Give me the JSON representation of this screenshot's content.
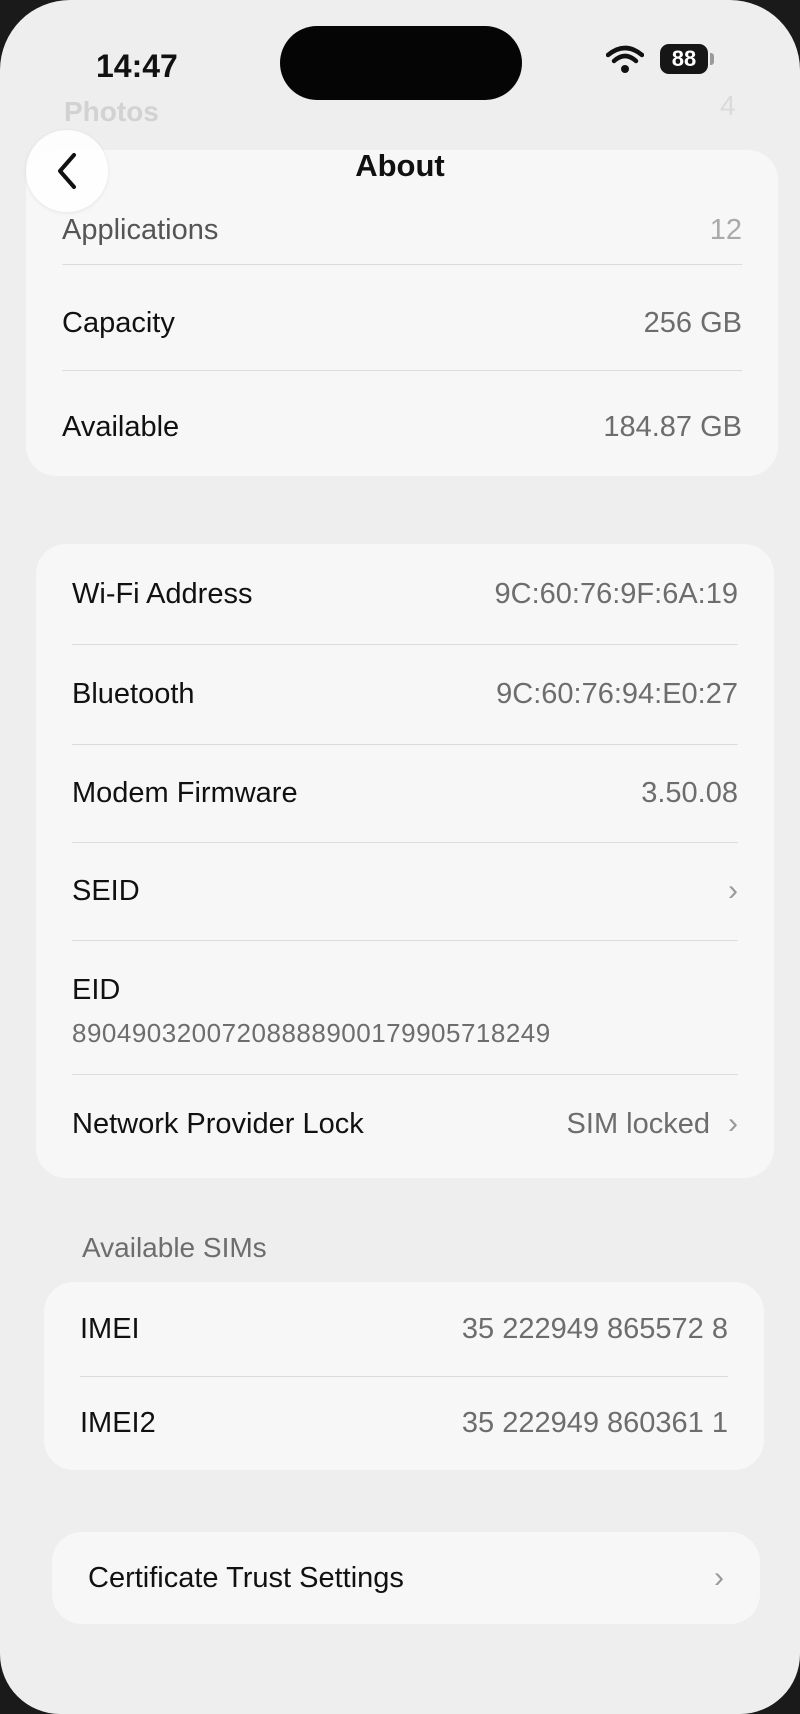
{
  "status_bar": {
    "time": "14:47",
    "battery": "88"
  },
  "ghost_header": {
    "title": "Photos",
    "value": "4"
  },
  "nav": {
    "title": "About"
  },
  "storage_group": [
    {
      "label": "Applications",
      "value": "12"
    },
    {
      "label": "Capacity",
      "value": "256 GB"
    },
    {
      "label": "Available",
      "value": "184.87 GB"
    }
  ],
  "hardware_group": {
    "wifi": {
      "label": "Wi-Fi Address",
      "value": "9C:60:76:9F:6A:19"
    },
    "bluetooth": {
      "label": "Bluetooth",
      "value": "9C:60:76:94:E0:27"
    },
    "modem": {
      "label": "Modem Firmware",
      "value": "3.50.08"
    },
    "seid": {
      "label": "SEID"
    },
    "eid": {
      "label": "EID",
      "value": "89049032007208888900179905718249"
    },
    "network_lock": {
      "label": "Network Provider Lock",
      "value": "SIM locked"
    }
  },
  "sims": {
    "header": "Available SIMs",
    "rows": [
      {
        "label": "IMEI",
        "value": "35 222949 865572 8"
      },
      {
        "label": "IMEI2",
        "value": "35 222949 860361 1"
      }
    ]
  },
  "certificate": {
    "label": "Certificate Trust Settings"
  }
}
